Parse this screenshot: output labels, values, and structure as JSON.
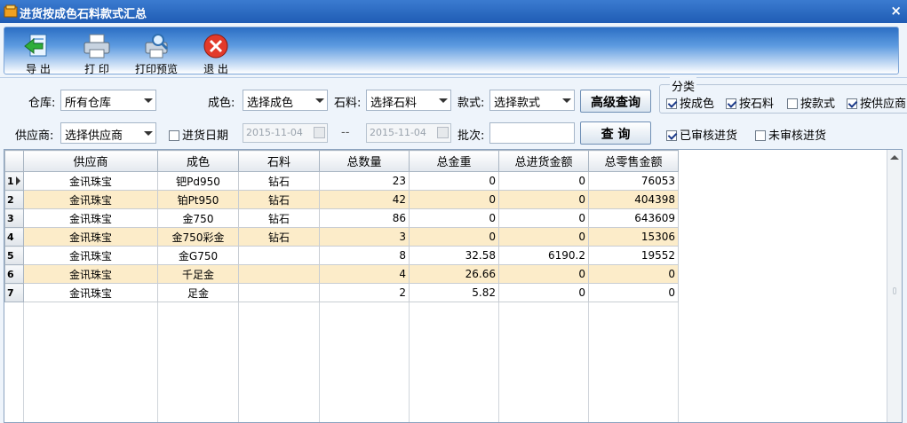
{
  "window": {
    "title": "进货按成色石料款式汇总",
    "close_glyph": "×"
  },
  "toolbar": {
    "export_label": "导 出",
    "print_label": "打 印",
    "preview_label": "打印预览",
    "exit_label": "退 出"
  },
  "filters": {
    "warehouse_label": "仓库:",
    "warehouse_value": "所有仓库",
    "color_label": "成色:",
    "color_value": "选择成色",
    "stone_label": "石料:",
    "stone_value": "选择石料",
    "style_label": "款式:",
    "style_value": "选择款式",
    "advanced_button": "高级查询",
    "supplier_label": "供应商:",
    "supplier_value": "选择供应商",
    "purchase_date_label": "进货日期",
    "date_from": "2015-11-04",
    "date_sep": "--",
    "date_to": "2015-11-04",
    "batch_label": "批次:",
    "batch_value": "",
    "query_button": "查  询",
    "audited_label": "已审核进货",
    "unaudited_label": "未审核进货"
  },
  "category": {
    "legend": "分类",
    "by_color": "按成色",
    "by_stone": "按石料",
    "by_style": "按款式",
    "by_supplier": "按供应商"
  },
  "grid": {
    "columns": [
      "供应商",
      "成色",
      "石料",
      "总数量",
      "总金重",
      "总进货金额",
      "总零售金额"
    ],
    "rows": [
      {
        "n": "1",
        "supplier": "金讯珠宝",
        "color": "钯Pd950",
        "stone": "钻石",
        "qty": "23",
        "weight": "0",
        "cost": "0",
        "retail": "76053"
      },
      {
        "n": "2",
        "supplier": "金讯珠宝",
        "color": "铂Pt950",
        "stone": "钻石",
        "qty": "42",
        "weight": "0",
        "cost": "0",
        "retail": "404398"
      },
      {
        "n": "3",
        "supplier": "金讯珠宝",
        "color": "金750",
        "stone": "钻石",
        "qty": "86",
        "weight": "0",
        "cost": "0",
        "retail": "643609"
      },
      {
        "n": "4",
        "supplier": "金讯珠宝",
        "color": "金750彩金",
        "stone": "钻石",
        "qty": "3",
        "weight": "0",
        "cost": "0",
        "retail": "15306"
      },
      {
        "n": "5",
        "supplier": "金讯珠宝",
        "color": "金G750",
        "stone": "",
        "qty": "8",
        "weight": "32.58",
        "cost": "6190.2",
        "retail": "19552"
      },
      {
        "n": "6",
        "supplier": "金讯珠宝",
        "color": "千足金",
        "stone": "",
        "qty": "4",
        "weight": "26.66",
        "cost": "0",
        "retail": "0"
      },
      {
        "n": "7",
        "supplier": "金讯珠宝",
        "color": "足金",
        "stone": "",
        "qty": "2",
        "weight": "5.82",
        "cost": "0",
        "retail": "0"
      }
    ]
  }
}
